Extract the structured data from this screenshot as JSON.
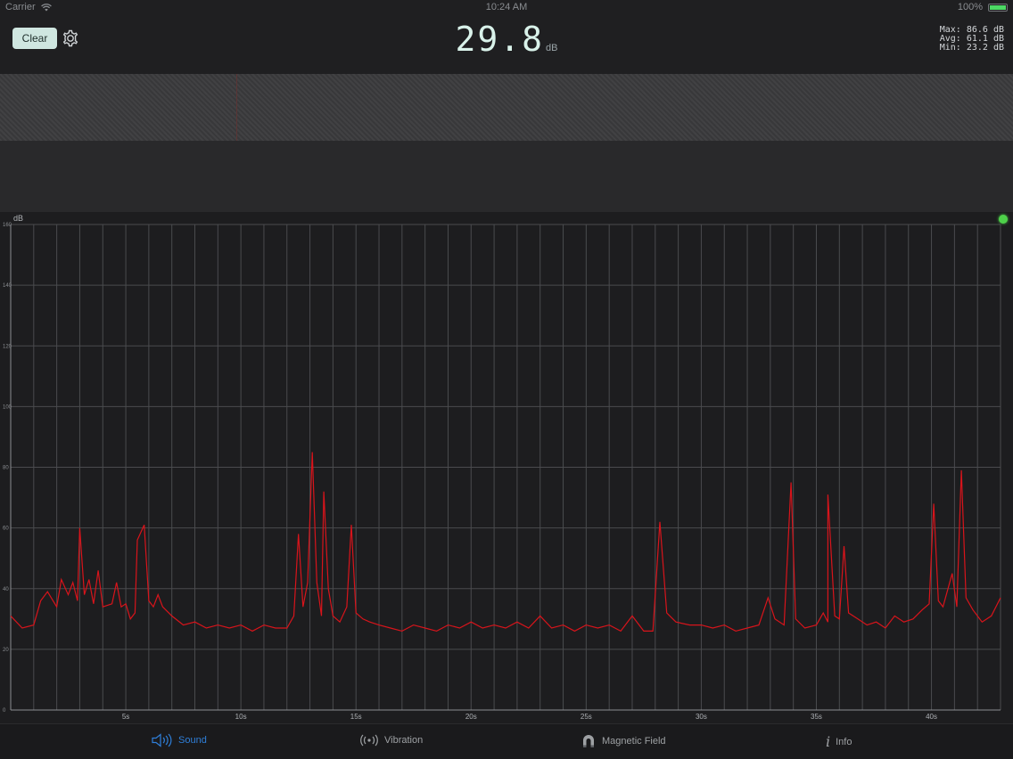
{
  "status": {
    "carrier": "Carrier",
    "time": "10:24 AM",
    "battery": "100%"
  },
  "toolbar": {
    "clear_label": "Clear",
    "value": "29.8",
    "unit": "dB",
    "stats": [
      "Max: 86.6 dB",
      "Avg: 61.1 dB",
      "Min: 23.2 dB"
    ]
  },
  "tabs": [
    {
      "label": "Sound",
      "icon": "speaker-icon",
      "active": true
    },
    {
      "label": "Vibration",
      "icon": "vibration-icon",
      "active": false
    },
    {
      "label": "Magnetic Field",
      "icon": "magnet-icon",
      "active": false
    },
    {
      "label": "Info",
      "icon": "info-icon",
      "active": false
    }
  ],
  "colors": {
    "accent": "#2f7fd9",
    "trace": "#d8141b",
    "live": "#4ed14a"
  },
  "chart_data": {
    "type": "line",
    "ylabel": "dB",
    "ylim": [
      0,
      160
    ],
    "y_ticks": [
      0,
      20,
      40,
      60,
      80,
      100,
      120,
      140,
      160
    ],
    "xlim": [
      0,
      43
    ],
    "x_ticks": [
      5,
      10,
      15,
      20,
      25,
      30,
      35,
      40
    ],
    "x_tick_labels": [
      "5s",
      "10s",
      "15s",
      "20s",
      "25s",
      "30s",
      "35s",
      "40s"
    ],
    "grid": true,
    "series": [
      {
        "values": [
          [
            0.0,
            31
          ],
          [
            0.5,
            27
          ],
          [
            1.0,
            28
          ],
          [
            1.3,
            36
          ],
          [
            1.6,
            39
          ],
          [
            2.0,
            34
          ],
          [
            2.2,
            43
          ],
          [
            2.5,
            38
          ],
          [
            2.7,
            42
          ],
          [
            2.9,
            36
          ],
          [
            3.0,
            60
          ],
          [
            3.2,
            38
          ],
          [
            3.4,
            43
          ],
          [
            3.6,
            35
          ],
          [
            3.8,
            46
          ],
          [
            4.0,
            34
          ],
          [
            4.4,
            35
          ],
          [
            4.6,
            42
          ],
          [
            4.8,
            34
          ],
          [
            5.0,
            35
          ],
          [
            5.2,
            30
          ],
          [
            5.4,
            32
          ],
          [
            5.5,
            56
          ],
          [
            5.8,
            61
          ],
          [
            6.0,
            36
          ],
          [
            6.2,
            34
          ],
          [
            6.4,
            38
          ],
          [
            6.6,
            34
          ],
          [
            7.0,
            31
          ],
          [
            7.5,
            28
          ],
          [
            8.0,
            29
          ],
          [
            8.5,
            27
          ],
          [
            9.0,
            28
          ],
          [
            9.5,
            27
          ],
          [
            10,
            28
          ],
          [
            10.5,
            26
          ],
          [
            11.0,
            28
          ],
          [
            11.5,
            27
          ],
          [
            12.0,
            27
          ],
          [
            12.3,
            31
          ],
          [
            12.5,
            58
          ],
          [
            12.7,
            34
          ],
          [
            12.9,
            42
          ],
          [
            13.1,
            85
          ],
          [
            13.3,
            42
          ],
          [
            13.5,
            31
          ],
          [
            13.6,
            72
          ],
          [
            13.8,
            40
          ],
          [
            14.0,
            31
          ],
          [
            14.3,
            29
          ],
          [
            14.6,
            34
          ],
          [
            14.8,
            61
          ],
          [
            15.0,
            32
          ],
          [
            15.3,
            30
          ],
          [
            15.6,
            29
          ],
          [
            16.0,
            28
          ],
          [
            16.5,
            27
          ],
          [
            17.0,
            26
          ],
          [
            17.5,
            28
          ],
          [
            18.0,
            27
          ],
          [
            18.5,
            26
          ],
          [
            19.0,
            28
          ],
          [
            19.5,
            27
          ],
          [
            20.0,
            29
          ],
          [
            20.5,
            27
          ],
          [
            21.0,
            28
          ],
          [
            21.5,
            27
          ],
          [
            22.0,
            29
          ],
          [
            22.5,
            27
          ],
          [
            23.0,
            31
          ],
          [
            23.5,
            27
          ],
          [
            24.0,
            28
          ],
          [
            24.5,
            26
          ],
          [
            25.0,
            28
          ],
          [
            25.5,
            27
          ],
          [
            26.0,
            28
          ],
          [
            26.5,
            26
          ],
          [
            27.0,
            31
          ],
          [
            27.5,
            26
          ],
          [
            27.9,
            26
          ],
          [
            28.2,
            62
          ],
          [
            28.5,
            32
          ],
          [
            28.9,
            29
          ],
          [
            29.5,
            28
          ],
          [
            30.0,
            28
          ],
          [
            30.5,
            27
          ],
          [
            31.0,
            28
          ],
          [
            31.5,
            26
          ],
          [
            32.0,
            27
          ],
          [
            32.5,
            28
          ],
          [
            32.9,
            37
          ],
          [
            33.2,
            30
          ],
          [
            33.6,
            28
          ],
          [
            33.9,
            75
          ],
          [
            34.1,
            30
          ],
          [
            34.5,
            27
          ],
          [
            35.0,
            28
          ],
          [
            35.3,
            32
          ],
          [
            35.5,
            29
          ],
          [
            35.5,
            71
          ],
          [
            35.8,
            31
          ],
          [
            36.0,
            30
          ],
          [
            36.2,
            54
          ],
          [
            36.4,
            32
          ],
          [
            36.8,
            30
          ],
          [
            37.2,
            28
          ],
          [
            37.6,
            29
          ],
          [
            38.0,
            27
          ],
          [
            38.4,
            31
          ],
          [
            38.8,
            29
          ],
          [
            39.2,
            30
          ],
          [
            39.6,
            33
          ],
          [
            39.9,
            35
          ],
          [
            40.1,
            68
          ],
          [
            40.3,
            36
          ],
          [
            40.5,
            34
          ],
          [
            40.9,
            45
          ],
          [
            41.1,
            34
          ],
          [
            41.3,
            79
          ],
          [
            41.5,
            37
          ],
          [
            41.8,
            33
          ],
          [
            42.2,
            29
          ],
          [
            42.6,
            31
          ],
          [
            43.0,
            37
          ]
        ]
      }
    ]
  }
}
